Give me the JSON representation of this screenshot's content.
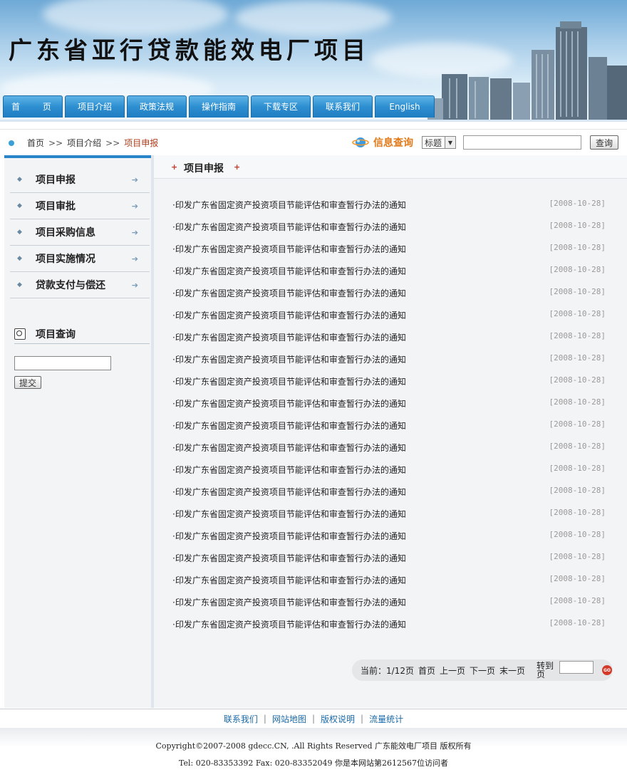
{
  "site": {
    "title": "广东省亚行贷款能效电厂项目"
  },
  "nav": [
    {
      "label": "首 页"
    },
    {
      "label": "项目介绍"
    },
    {
      "label": "政策法规"
    },
    {
      "label": "操作指南"
    },
    {
      "label": "下载专区"
    },
    {
      "label": "联系我们"
    },
    {
      "label": "English"
    }
  ],
  "breadcrumb": {
    "home": "首页",
    "sep": ">>",
    "level1": "项目介绍",
    "current": "项目申报"
  },
  "search": {
    "label": "信息查询",
    "select_value": "标题",
    "button": "查询"
  },
  "sidebar": {
    "menu": [
      {
        "label": "项目申报"
      },
      {
        "label": "项目审批"
      },
      {
        "label": "项目采购信息"
      },
      {
        "label": "项目实施情况"
      },
      {
        "label": "贷款支付与偿还"
      }
    ],
    "query_title": "项目查询",
    "submit": "提交"
  },
  "main": {
    "title": "项目申报",
    "items": [
      {
        "title": "·印发广东省固定资产投资项目节能评估和审查暂行办法的通知",
        "date": "[2008-10-28]"
      },
      {
        "title": "·印发广东省固定资产投资项目节能评估和审查暂行办法的通知",
        "date": "[2008-10-28]"
      },
      {
        "title": "·印发广东省固定资产投资项目节能评估和审查暂行办法的通知",
        "date": "[2008-10-28]"
      },
      {
        "title": "·印发广东省固定资产投资项目节能评估和审查暂行办法的通知",
        "date": "[2008-10-28]"
      },
      {
        "title": "·印发广东省固定资产投资项目节能评估和审查暂行办法的通知",
        "date": "[2008-10-28]"
      },
      {
        "title": "·印发广东省固定资产投资项目节能评估和审查暂行办法的通知",
        "date": "[2008-10-28]"
      },
      {
        "title": "·印发广东省固定资产投资项目节能评估和审查暂行办法的通知",
        "date": "[2008-10-28]"
      },
      {
        "title": "·印发广东省固定资产投资项目节能评估和审查暂行办法的通知",
        "date": "[2008-10-28]"
      },
      {
        "title": "·印发广东省固定资产投资项目节能评估和审查暂行办法的通知",
        "date": "[2008-10-28]"
      },
      {
        "title": "·印发广东省固定资产投资项目节能评估和审查暂行办法的通知",
        "date": "[2008-10-28]"
      },
      {
        "title": "·印发广东省固定资产投资项目节能评估和审查暂行办法的通知",
        "date": "[2008-10-28]"
      },
      {
        "title": "·印发广东省固定资产投资项目节能评估和审查暂行办法的通知",
        "date": "[2008-10-28]"
      },
      {
        "title": "·印发广东省固定资产投资项目节能评估和审查暂行办法的通知",
        "date": "[2008-10-28]"
      },
      {
        "title": "·印发广东省固定资产投资项目节能评估和审查暂行办法的通知",
        "date": "[2008-10-28]"
      },
      {
        "title": "·印发广东省固定资产投资项目节能评估和审查暂行办法的通知",
        "date": "[2008-10-28]"
      },
      {
        "title": "·印发广东省固定资产投资项目节能评估和审查暂行办法的通知",
        "date": "[2008-10-28]"
      },
      {
        "title": "·印发广东省固定资产投资项目节能评估和审查暂行办法的通知",
        "date": "[2008-10-28]"
      },
      {
        "title": "·印发广东省固定资产投资项目节能评估和审查暂行办法的通知",
        "date": "[2008-10-28]"
      },
      {
        "title": "·印发广东省固定资产投资项目节能评估和审查暂行办法的通知",
        "date": "[2008-10-28]"
      },
      {
        "title": "·印发广东省固定资产投资项目节能评估和审查暂行办法的通知",
        "date": "[2008-10-28]"
      }
    ]
  },
  "pager": {
    "current": "当前：1/12页",
    "first": "首页",
    "prev": "上一页",
    "next": "下一页",
    "last": "末一页",
    "goto": "转到页",
    "go": "GO"
  },
  "footer": {
    "links": [
      "联系我们",
      "网站地图",
      "版权说明",
      "流量统计"
    ],
    "copyright": "Copyright©2007-2008 gdecc.CN, .All Rights Reserved 广东能效电厂项目 版权所有",
    "contact": "Tel: 020-83353392 Fax: 020-83352049 你是本网站第2612567位访问者"
  }
}
